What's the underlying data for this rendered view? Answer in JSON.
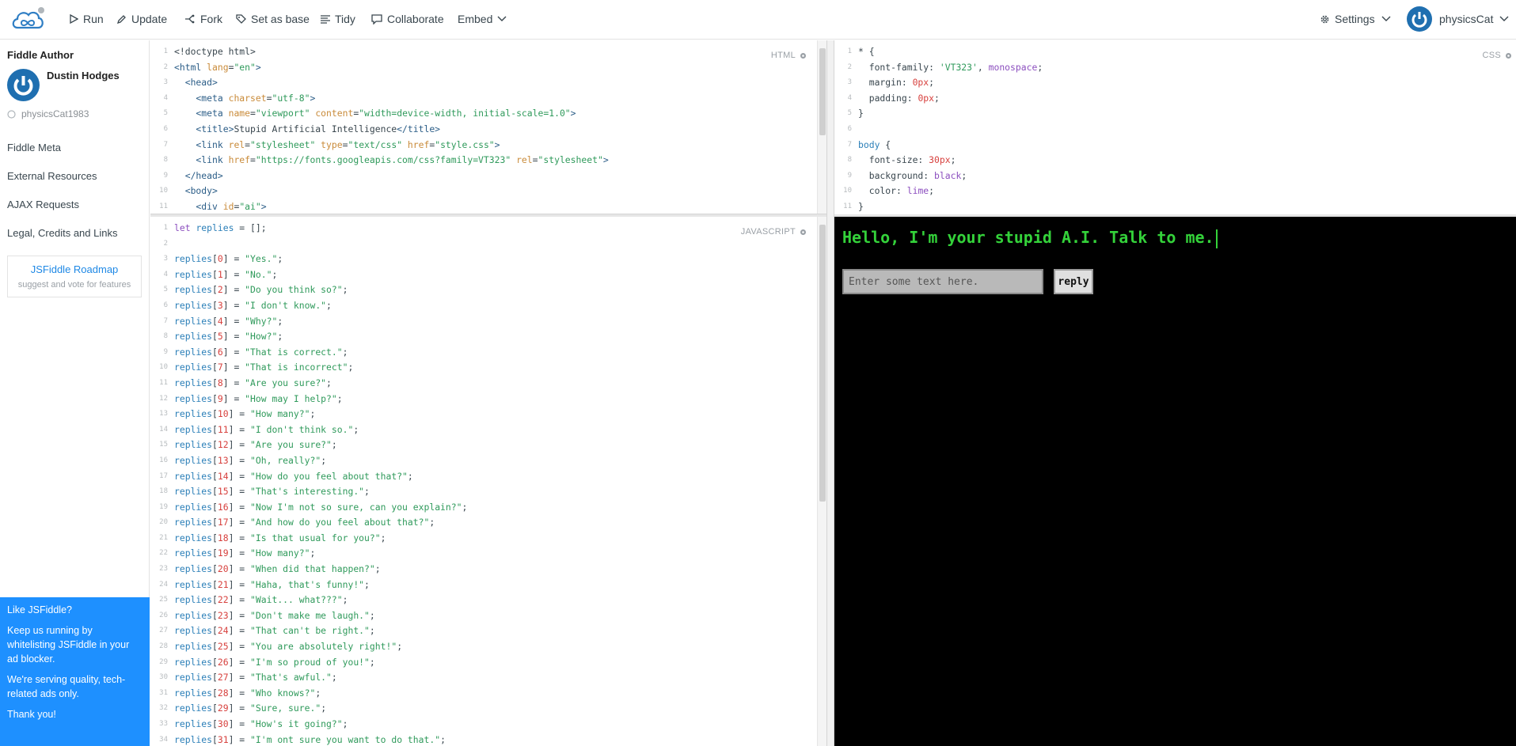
{
  "header": {
    "run_label": "Run",
    "update_label": "Update",
    "fork_label": "Fork",
    "set_base_label": "Set as base",
    "tidy_label": "Tidy",
    "collaborate_label": "Collaborate",
    "embed_label": "Embed",
    "settings_label": "Settings",
    "username": "physicsCat"
  },
  "sidebar": {
    "author_heading": "Fiddle Author",
    "author_name": "Dustin Hodges",
    "author_handle": "physicsCat1983",
    "links": [
      "Fiddle Meta",
      "External Resources",
      "AJAX Requests",
      "Legal, Credits and Links"
    ],
    "roadmap_title": "JSFiddle Roadmap",
    "roadmap_sub": "suggest and vote for features",
    "ad": {
      "title": "Like JSFiddle?",
      "p1": "Keep us running by whitelisting JSFiddle in your ad blocker.",
      "p2": "We're serving quality, tech-related ads only.",
      "p3": "Thank you!"
    }
  },
  "panes": {
    "html_label": "HTML",
    "css_label": "CSS",
    "js_label": "JAVASCRIPT"
  },
  "html_code": [
    [
      [
        "<!doctype html>",
        "plain"
      ]
    ],
    [
      [
        "<html",
        "tag"
      ],
      [
        " lang",
        "attr"
      ],
      [
        "=",
        "plain"
      ],
      [
        "\"en\"",
        "str"
      ],
      [
        ">",
        "tag"
      ]
    ],
    [
      [
        "  <head>",
        "tag"
      ]
    ],
    [
      [
        "    <meta",
        "tag"
      ],
      [
        " charset",
        "attr"
      ],
      [
        "=",
        "plain"
      ],
      [
        "\"utf-8\"",
        "str"
      ],
      [
        ">",
        "tag"
      ]
    ],
    [
      [
        "    <meta",
        "tag"
      ],
      [
        " name",
        "attr"
      ],
      [
        "=",
        "plain"
      ],
      [
        "\"viewport\"",
        "str"
      ],
      [
        " content",
        "attr"
      ],
      [
        "=",
        "plain"
      ],
      [
        "\"width=device-width, initial-scale=1.0\"",
        "str"
      ],
      [
        ">",
        "tag"
      ]
    ],
    [
      [
        "    <title>",
        "tag"
      ],
      [
        "Stupid Artificial Intelligence",
        "plain"
      ],
      [
        "</title>",
        "tag"
      ]
    ],
    [
      [
        "    <link",
        "tag"
      ],
      [
        " rel",
        "attr"
      ],
      [
        "=",
        "plain"
      ],
      [
        "\"stylesheet\"",
        "str"
      ],
      [
        " type",
        "attr"
      ],
      [
        "=",
        "plain"
      ],
      [
        "\"text/css\"",
        "str"
      ],
      [
        " href",
        "attr"
      ],
      [
        "=",
        "plain"
      ],
      [
        "\"style.css\"",
        "str"
      ],
      [
        ">",
        "tag"
      ]
    ],
    [
      [
        "    <link",
        "tag"
      ],
      [
        " href",
        "attr"
      ],
      [
        "=",
        "plain"
      ],
      [
        "\"https://fonts.googleapis.com/css?family=VT323\"",
        "str"
      ],
      [
        " rel",
        "attr"
      ],
      [
        "=",
        "plain"
      ],
      [
        "\"stylesheet\"",
        "str"
      ],
      [
        ">",
        "tag"
      ]
    ],
    [
      [
        "  </head>",
        "tag"
      ]
    ],
    [
      [
        "  <body>",
        "tag"
      ]
    ],
    [
      [
        "    <div",
        "tag"
      ],
      [
        " id",
        "attr"
      ],
      [
        "=",
        "plain"
      ],
      [
        "\"ai\"",
        "str"
      ],
      [
        ">",
        "tag"
      ]
    ]
  ],
  "css_code": [
    [
      [
        "* {",
        "plain"
      ]
    ],
    [
      [
        "  font-family: ",
        "plain"
      ],
      [
        "'VT323'",
        "str"
      ],
      [
        ", ",
        "plain"
      ],
      [
        "monospace",
        "kw"
      ],
      [
        ";",
        "plain"
      ]
    ],
    [
      [
        "  margin: ",
        "plain"
      ],
      [
        "0px",
        "num"
      ],
      [
        ";",
        "plain"
      ]
    ],
    [
      [
        "  padding: ",
        "plain"
      ],
      [
        "0px",
        "num"
      ],
      [
        ";",
        "plain"
      ]
    ],
    [
      [
        "}",
        "plain"
      ]
    ],
    [
      [
        "",
        "plain"
      ]
    ],
    [
      [
        "body",
        "sel"
      ],
      [
        " {",
        "plain"
      ]
    ],
    [
      [
        "  font-size: ",
        "plain"
      ],
      [
        "30px",
        "num"
      ],
      [
        ";",
        "plain"
      ]
    ],
    [
      [
        "  background: ",
        "plain"
      ],
      [
        "black",
        "kw"
      ],
      [
        ";",
        "plain"
      ]
    ],
    [
      [
        "  color: ",
        "plain"
      ],
      [
        "lime",
        "kw"
      ],
      [
        ";",
        "plain"
      ]
    ],
    [
      [
        "}",
        "plain"
      ]
    ]
  ],
  "js_code": [
    [
      [
        "let ",
        "kw"
      ],
      [
        "replies",
        "var"
      ],
      [
        " = [];",
        "plain"
      ]
    ],
    [
      [
        "",
        "plain"
      ]
    ],
    [
      [
        "replies",
        "var"
      ],
      [
        "[",
        "plain"
      ],
      [
        "0",
        "num"
      ],
      [
        "] = ",
        "plain"
      ],
      [
        "\"Yes.\"",
        "str"
      ],
      [
        ";",
        "plain"
      ]
    ],
    [
      [
        "replies",
        "var"
      ],
      [
        "[",
        "plain"
      ],
      [
        "1",
        "num"
      ],
      [
        "] = ",
        "plain"
      ],
      [
        "\"No.\"",
        "str"
      ],
      [
        ";",
        "plain"
      ]
    ],
    [
      [
        "replies",
        "var"
      ],
      [
        "[",
        "plain"
      ],
      [
        "2",
        "num"
      ],
      [
        "] = ",
        "plain"
      ],
      [
        "\"Do you think so?\"",
        "str"
      ],
      [
        ";",
        "plain"
      ]
    ],
    [
      [
        "replies",
        "var"
      ],
      [
        "[",
        "plain"
      ],
      [
        "3",
        "num"
      ],
      [
        "] = ",
        "plain"
      ],
      [
        "\"I don't know.\"",
        "str"
      ],
      [
        ";",
        "plain"
      ]
    ],
    [
      [
        "replies",
        "var"
      ],
      [
        "[",
        "plain"
      ],
      [
        "4",
        "num"
      ],
      [
        "] = ",
        "plain"
      ],
      [
        "\"Why?\"",
        "str"
      ],
      [
        ";",
        "plain"
      ]
    ],
    [
      [
        "replies",
        "var"
      ],
      [
        "[",
        "plain"
      ],
      [
        "5",
        "num"
      ],
      [
        "] = ",
        "plain"
      ],
      [
        "\"How?\"",
        "str"
      ],
      [
        ";",
        "plain"
      ]
    ],
    [
      [
        "replies",
        "var"
      ],
      [
        "[",
        "plain"
      ],
      [
        "6",
        "num"
      ],
      [
        "] = ",
        "plain"
      ],
      [
        "\"That is correct.\"",
        "str"
      ],
      [
        ";",
        "plain"
      ]
    ],
    [
      [
        "replies",
        "var"
      ],
      [
        "[",
        "plain"
      ],
      [
        "7",
        "num"
      ],
      [
        "] = ",
        "plain"
      ],
      [
        "\"That is incorrect\"",
        "str"
      ],
      [
        ";",
        "plain"
      ]
    ],
    [
      [
        "replies",
        "var"
      ],
      [
        "[",
        "plain"
      ],
      [
        "8",
        "num"
      ],
      [
        "] = ",
        "plain"
      ],
      [
        "\"Are you sure?\"",
        "str"
      ],
      [
        ";",
        "plain"
      ]
    ],
    [
      [
        "replies",
        "var"
      ],
      [
        "[",
        "plain"
      ],
      [
        "9",
        "num"
      ],
      [
        "] = ",
        "plain"
      ],
      [
        "\"How may I help?\"",
        "str"
      ],
      [
        ";",
        "plain"
      ]
    ],
    [
      [
        "replies",
        "var"
      ],
      [
        "[",
        "plain"
      ],
      [
        "10",
        "num"
      ],
      [
        "] = ",
        "plain"
      ],
      [
        "\"How many?\"",
        "str"
      ],
      [
        ";",
        "plain"
      ]
    ],
    [
      [
        "replies",
        "var"
      ],
      [
        "[",
        "plain"
      ],
      [
        "11",
        "num"
      ],
      [
        "] = ",
        "plain"
      ],
      [
        "\"I don't think so.\"",
        "str"
      ],
      [
        ";",
        "plain"
      ]
    ],
    [
      [
        "replies",
        "var"
      ],
      [
        "[",
        "plain"
      ],
      [
        "12",
        "num"
      ],
      [
        "] = ",
        "plain"
      ],
      [
        "\"Are you sure?\"",
        "str"
      ],
      [
        ";",
        "plain"
      ]
    ],
    [
      [
        "replies",
        "var"
      ],
      [
        "[",
        "plain"
      ],
      [
        "13",
        "num"
      ],
      [
        "] = ",
        "plain"
      ],
      [
        "\"Oh, really?\"",
        "str"
      ],
      [
        ";",
        "plain"
      ]
    ],
    [
      [
        "replies",
        "var"
      ],
      [
        "[",
        "plain"
      ],
      [
        "14",
        "num"
      ],
      [
        "] = ",
        "plain"
      ],
      [
        "\"How do you feel about that?\"",
        "str"
      ],
      [
        ";",
        "plain"
      ]
    ],
    [
      [
        "replies",
        "var"
      ],
      [
        "[",
        "plain"
      ],
      [
        "15",
        "num"
      ],
      [
        "] = ",
        "plain"
      ],
      [
        "\"That's interesting.\"",
        "str"
      ],
      [
        ";",
        "plain"
      ]
    ],
    [
      [
        "replies",
        "var"
      ],
      [
        "[",
        "plain"
      ],
      [
        "16",
        "num"
      ],
      [
        "] = ",
        "plain"
      ],
      [
        "\"Now I'm not so sure, can you explain?\"",
        "str"
      ],
      [
        ";",
        "plain"
      ]
    ],
    [
      [
        "replies",
        "var"
      ],
      [
        "[",
        "plain"
      ],
      [
        "17",
        "num"
      ],
      [
        "] = ",
        "plain"
      ],
      [
        "\"And how do you feel about that?\"",
        "str"
      ],
      [
        ";",
        "plain"
      ]
    ],
    [
      [
        "replies",
        "var"
      ],
      [
        "[",
        "plain"
      ],
      [
        "18",
        "num"
      ],
      [
        "] = ",
        "plain"
      ],
      [
        "\"Is that usual for you?\"",
        "str"
      ],
      [
        ";",
        "plain"
      ]
    ],
    [
      [
        "replies",
        "var"
      ],
      [
        "[",
        "plain"
      ],
      [
        "19",
        "num"
      ],
      [
        "] = ",
        "plain"
      ],
      [
        "\"How many?\"",
        "str"
      ],
      [
        ";",
        "plain"
      ]
    ],
    [
      [
        "replies",
        "var"
      ],
      [
        "[",
        "plain"
      ],
      [
        "20",
        "num"
      ],
      [
        "] = ",
        "plain"
      ],
      [
        "\"When did that happen?\"",
        "str"
      ],
      [
        ";",
        "plain"
      ]
    ],
    [
      [
        "replies",
        "var"
      ],
      [
        "[",
        "plain"
      ],
      [
        "21",
        "num"
      ],
      [
        "] = ",
        "plain"
      ],
      [
        "\"Haha, that's funny!\"",
        "str"
      ],
      [
        ";",
        "plain"
      ]
    ],
    [
      [
        "replies",
        "var"
      ],
      [
        "[",
        "plain"
      ],
      [
        "22",
        "num"
      ],
      [
        "] = ",
        "plain"
      ],
      [
        "\"Wait... what???\"",
        "str"
      ],
      [
        ";",
        "plain"
      ]
    ],
    [
      [
        "replies",
        "var"
      ],
      [
        "[",
        "plain"
      ],
      [
        "23",
        "num"
      ],
      [
        "] = ",
        "plain"
      ],
      [
        "\"Don't make me laugh.\"",
        "str"
      ],
      [
        ";",
        "plain"
      ]
    ],
    [
      [
        "replies",
        "var"
      ],
      [
        "[",
        "plain"
      ],
      [
        "24",
        "num"
      ],
      [
        "] = ",
        "plain"
      ],
      [
        "\"That can't be right.\"",
        "str"
      ],
      [
        ";",
        "plain"
      ]
    ],
    [
      [
        "replies",
        "var"
      ],
      [
        "[",
        "plain"
      ],
      [
        "25",
        "num"
      ],
      [
        "] = ",
        "plain"
      ],
      [
        "\"You are absolutely right!\"",
        "str"
      ],
      [
        ";",
        "plain"
      ]
    ],
    [
      [
        "replies",
        "var"
      ],
      [
        "[",
        "plain"
      ],
      [
        "26",
        "num"
      ],
      [
        "] = ",
        "plain"
      ],
      [
        "\"I'm so proud of you!\"",
        "str"
      ],
      [
        ";",
        "plain"
      ]
    ],
    [
      [
        "replies",
        "var"
      ],
      [
        "[",
        "plain"
      ],
      [
        "27",
        "num"
      ],
      [
        "] = ",
        "plain"
      ],
      [
        "\"That's awful.\"",
        "str"
      ],
      [
        ";",
        "plain"
      ]
    ],
    [
      [
        "replies",
        "var"
      ],
      [
        "[",
        "plain"
      ],
      [
        "28",
        "num"
      ],
      [
        "] = ",
        "plain"
      ],
      [
        "\"Who knows?\"",
        "str"
      ],
      [
        ";",
        "plain"
      ]
    ],
    [
      [
        "replies",
        "var"
      ],
      [
        "[",
        "plain"
      ],
      [
        "29",
        "num"
      ],
      [
        "] = ",
        "plain"
      ],
      [
        "\"Sure, sure.\"",
        "str"
      ],
      [
        ";",
        "plain"
      ]
    ],
    [
      [
        "replies",
        "var"
      ],
      [
        "[",
        "plain"
      ],
      [
        "30",
        "num"
      ],
      [
        "] = ",
        "plain"
      ],
      [
        "\"How's it going?\"",
        "str"
      ],
      [
        ";",
        "plain"
      ]
    ],
    [
      [
        "replies",
        "var"
      ],
      [
        "[",
        "plain"
      ],
      [
        "31",
        "num"
      ],
      [
        "] = ",
        "plain"
      ],
      [
        "\"I'm ont sure you want to do that.\"",
        "str"
      ],
      [
        ";",
        "plain"
      ]
    ]
  ],
  "result": {
    "greeting": "Hello, I'm your stupid A.I. Talk to me.",
    "input_placeholder": "Enter some text here.",
    "reply_label": "reply"
  },
  "colors": {
    "accent_blue": "#1e90ff",
    "result_green": "#34d23a",
    "result_bg": "#000000"
  }
}
